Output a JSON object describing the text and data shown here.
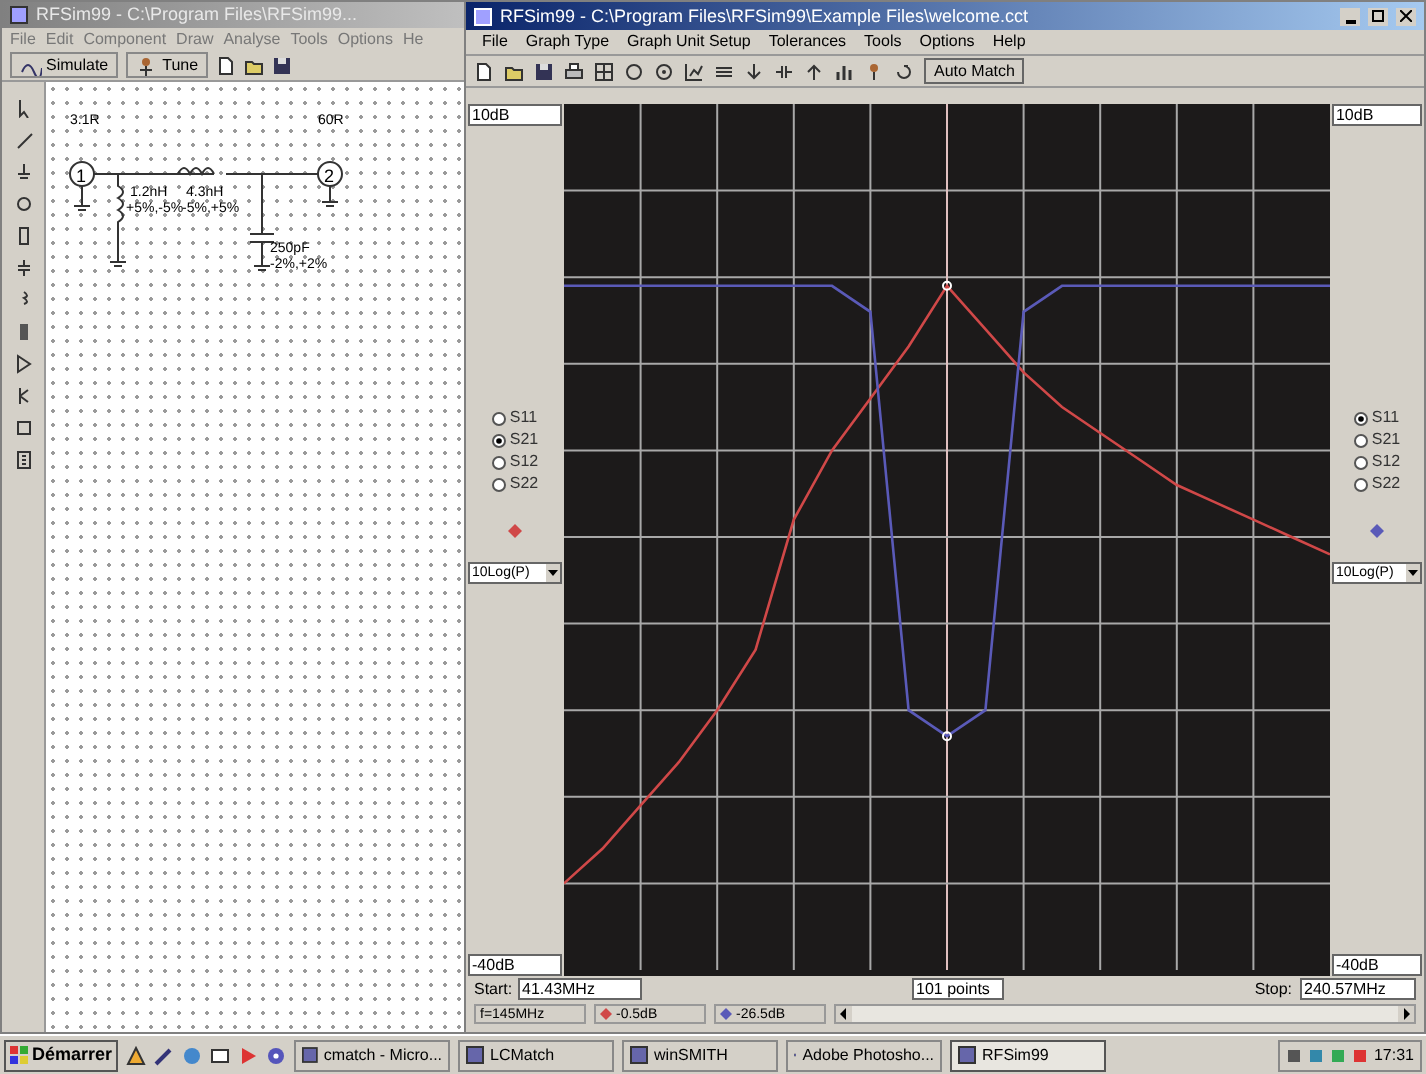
{
  "back_window": {
    "title": "RFSim99 - C:\\Program Files\\RFSim99...",
    "menu": [
      "File",
      "Edit",
      "Component",
      "Draw",
      "Analyse",
      "Tools",
      "Options",
      "He"
    ],
    "toolbar_buttons": [
      "Simulate",
      "Tune"
    ]
  },
  "schematic": {
    "port_1": {
      "number": "1",
      "label": "3.1R"
    },
    "port_2": {
      "number": "2",
      "label": "60R"
    },
    "labels": [
      "1.2nH",
      "4.3nH",
      "+5%,-5%",
      "-5%,+5%",
      "250pF",
      "-2%,+2%"
    ]
  },
  "main_window": {
    "title": "RFSim99 - C:\\Program Files\\RFSim99\\Example Files\\welcome.cct",
    "menu": [
      "File",
      "Graph Type",
      "Graph Unit Setup",
      "Tolerances",
      "Tools",
      "Options",
      "Help"
    ],
    "auto_match": "Auto Match"
  },
  "graph": {
    "left_top": "10dB",
    "left_bottom": "-40dB",
    "right_top": "10dB",
    "right_bottom": "-40dB",
    "left_params": [
      {
        "label": "S11",
        "selected": false
      },
      {
        "label": "S21",
        "selected": true
      },
      {
        "label": "S12",
        "selected": false
      },
      {
        "label": "S22",
        "selected": false
      }
    ],
    "right_params": [
      {
        "label": "S11",
        "selected": true
      },
      {
        "label": "S21",
        "selected": false
      },
      {
        "label": "S12",
        "selected": false
      },
      {
        "label": "S22",
        "selected": false
      }
    ],
    "left_scale": "10Log(P)",
    "right_scale": "10Log(P)",
    "start_label": "Start:",
    "start": "41.43MHz",
    "points": "101 points",
    "stop_label": "Stop:",
    "stop": "240.57MHz"
  },
  "status": {
    "frequency": "f=145MHz",
    "readings": [
      "-0.5dB",
      "-26.5dB"
    ]
  },
  "taskbar": {
    "start": "Démarrer",
    "tasks": [
      {
        "label": "cmatch - Micro...",
        "selected": false
      },
      {
        "label": "LCMatch",
        "selected": false
      },
      {
        "label": "winSMITH",
        "selected": false
      },
      {
        "label": "Adobe Photosho...",
        "selected": false
      },
      {
        "label": "RFSim99",
        "selected": true
      }
    ],
    "clock": "17:31"
  }
}
